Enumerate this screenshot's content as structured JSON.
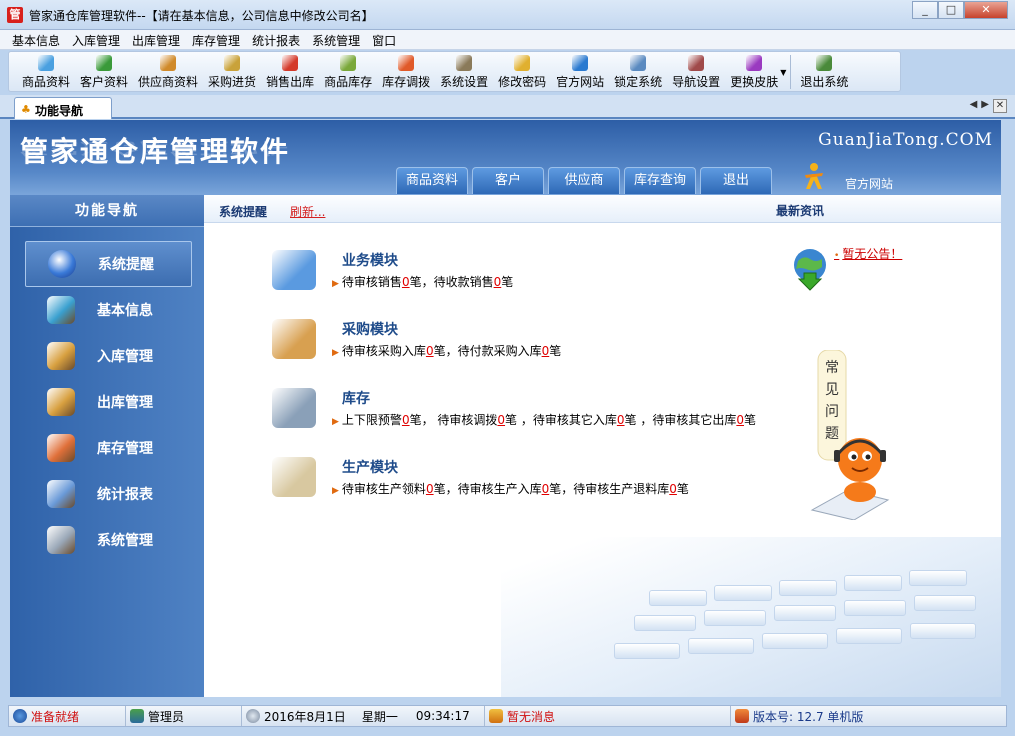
{
  "window": {
    "title": "管家通仓库管理软件--【请在基本信息，公司信息中修改公司名】",
    "app_icon": "管"
  },
  "menu": [
    "基本信息",
    "入库管理",
    "出库管理",
    "库存管理",
    "统计报表",
    "系统管理",
    "窗口"
  ],
  "toolbar": [
    {
      "label": "商品资料",
      "icon": "product-icon",
      "color": "#4aa0e0"
    },
    {
      "label": "客户资料",
      "icon": "customer-icon",
      "color": "#3a9a3a"
    },
    {
      "label": "供应商资料",
      "icon": "supplier-icon",
      "color": "#d08a2a"
    },
    {
      "label": "采购进货",
      "icon": "purchase-icon",
      "color": "#c9a23a"
    },
    {
      "label": "销售出库",
      "icon": "sales-icon",
      "color": "#d43a2a"
    },
    {
      "label": "商品库存",
      "icon": "stock-icon",
      "color": "#7aa83a"
    },
    {
      "label": "库存调拨",
      "icon": "transfer-icon",
      "color": "#e05a2a"
    },
    {
      "label": "系统设置",
      "icon": "settings-icon",
      "color": "#8a7a5a"
    },
    {
      "label": "修改密码",
      "icon": "password-icon",
      "color": "#e0b030"
    },
    {
      "label": "官方网站",
      "icon": "ie-icon",
      "color": "#2a7ad0"
    },
    {
      "label": "锁定系统",
      "icon": "lock-icon",
      "color": "#5a8ac0"
    },
    {
      "label": "导航设置",
      "icon": "nav-settings-icon",
      "color": "#a04a4a"
    },
    {
      "label": "更换皮肤",
      "icon": "skin-icon",
      "color": "#9a3ac0"
    },
    {
      "label": "退出系统",
      "icon": "exit-icon",
      "color": "#4a8a3a"
    }
  ],
  "tab": {
    "label": "功能导航"
  },
  "banner": {
    "title": "管家通仓库管理软件",
    "site": "GuanJiaTong.COM",
    "tabs": [
      "商品资料",
      "客户",
      "供应商",
      "库存查询",
      "退出"
    ],
    "official": "官方网站"
  },
  "sidebar": {
    "header": "功能导航",
    "items": [
      {
        "label": "系统提醒",
        "icon": "info-icon",
        "color": "#3a7ad8"
      },
      {
        "label": "基本信息",
        "icon": "cubes-icon",
        "color": "#3aa0d0"
      },
      {
        "label": "入库管理",
        "icon": "box-in-icon",
        "color": "#d8a040"
      },
      {
        "label": "出库管理",
        "icon": "box-out-icon",
        "color": "#d8a040"
      },
      {
        "label": "库存管理",
        "icon": "house-icon",
        "color": "#e0703a"
      },
      {
        "label": "统计报表",
        "icon": "chart-icon",
        "color": "#6a9ad8"
      },
      {
        "label": "系统管理",
        "icon": "gears-icon",
        "color": "#9aa8b8"
      }
    ]
  },
  "content": {
    "header_sys": "系统提醒",
    "refresh": "刷新...",
    "news": "最新资讯",
    "notice": "暂无公告！",
    "faq": "常见问题",
    "modules": [
      {
        "title": "业务模块",
        "icon": "folder-icon",
        "parts": [
          "待审核销售",
          "0",
          "笔，待收款销售",
          "0",
          "笔"
        ]
      },
      {
        "title": "采购模块",
        "icon": "package-icon",
        "parts": [
          "待审核采购入库",
          "0",
          "笔，待付款采购入库",
          "0",
          "笔"
        ]
      },
      {
        "title": "库存",
        "icon": "database-icon",
        "parts": [
          "上下限预警",
          "0",
          "笔， 待审核调拨",
          "0",
          "笔 ，待审核其它入库",
          "0",
          "笔 ，待审核其它出库",
          "0",
          "笔"
        ]
      },
      {
        "title": "生产模块",
        "icon": "clipboard-icon",
        "parts": [
          "待审核生产领料",
          "0",
          "笔，待审核生产入库",
          "0",
          "笔，待审核生产退料库",
          "0",
          "笔"
        ]
      }
    ]
  },
  "status": {
    "ready": "准备就绪",
    "user": "管理员",
    "date": "2016年8月1日",
    "weekday": "星期一",
    "time": "09:34:17",
    "message": "暂无消息",
    "version": "版本号: 12.7 单机版"
  }
}
